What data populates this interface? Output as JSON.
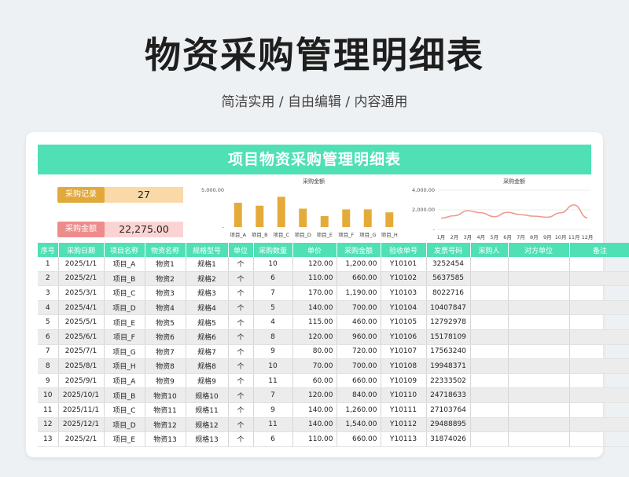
{
  "page": {
    "title": "物资采购管理明细表",
    "subtitle": "简洁实用 / 自由编辑 / 内容通用"
  },
  "sheet": {
    "banner": "项目物资采购管理明细表",
    "kpis": [
      {
        "label": "采购记录",
        "value": "27",
        "color": "#e2a93a"
      },
      {
        "label": "采购金额",
        "value": "22,275.00",
        "color": "#ee8c8c"
      }
    ]
  },
  "chart_data": [
    {
      "type": "bar",
      "title": "采购金额",
      "categories": [
        "项目_A",
        "项目_B",
        "项目_C",
        "项目_D",
        "项目_E",
        "项目_F",
        "项目_G",
        "项目_H"
      ],
      "values": [
        3300,
        2900,
        4100,
        2500,
        1500,
        2400,
        2400,
        2000
      ],
      "ylim": [
        0,
        5000
      ],
      "y_ticks": [
        "5,000.00",
        "-"
      ],
      "color": "#e5ab3a",
      "grid": false
    },
    {
      "type": "line",
      "title": "采购金额",
      "categories": [
        "1月",
        "2月",
        "3月",
        "4月",
        "5月",
        "6月",
        "7月",
        "8月",
        "9月",
        "10月",
        "11月",
        "12月"
      ],
      "values": [
        1150,
        1400,
        1900,
        1700,
        1300,
        1750,
        1500,
        1350,
        1250,
        1700,
        2500,
        1200
      ],
      "ylim": [
        0,
        4000
      ],
      "y_ticks": [
        "4,000.00",
        "2,000.00",
        "-"
      ],
      "color": "#ec9c8c",
      "grid": true
    }
  ],
  "table": {
    "headers": [
      "序号",
      "采购日期",
      "项目名称",
      "物资名称",
      "规格型号",
      "单位",
      "采购数量",
      "单价",
      "采购金额",
      "验收单号",
      "发票号码",
      "采购人",
      "对方单位",
      "备注"
    ],
    "rows": [
      [
        "1",
        "2025/1/1",
        "项目_A",
        "物资1",
        "规格1",
        "个",
        "10",
        "120.00",
        "1,200.00",
        "Y10101",
        "3252454",
        "",
        "",
        ""
      ],
      [
        "2",
        "2025/2/1",
        "项目_B",
        "物资2",
        "规格2",
        "个",
        "6",
        "110.00",
        "660.00",
        "Y10102",
        "5637585",
        "",
        "",
        ""
      ],
      [
        "3",
        "2025/3/1",
        "项目_C",
        "物资3",
        "规格3",
        "个",
        "7",
        "170.00",
        "1,190.00",
        "Y10103",
        "8022716",
        "",
        "",
        ""
      ],
      [
        "4",
        "2025/4/1",
        "项目_D",
        "物资4",
        "规格4",
        "个",
        "5",
        "140.00",
        "700.00",
        "Y10104",
        "10407847",
        "",
        "",
        ""
      ],
      [
        "5",
        "2025/5/1",
        "项目_E",
        "物资5",
        "规格5",
        "个",
        "4",
        "115.00",
        "460.00",
        "Y10105",
        "12792978",
        "",
        "",
        ""
      ],
      [
        "6",
        "2025/6/1",
        "项目_F",
        "物资6",
        "规格6",
        "个",
        "8",
        "120.00",
        "960.00",
        "Y10106",
        "15178109",
        "",
        "",
        ""
      ],
      [
        "7",
        "2025/7/1",
        "项目_G",
        "物资7",
        "规格7",
        "个",
        "9",
        "80.00",
        "720.00",
        "Y10107",
        "17563240",
        "",
        "",
        ""
      ],
      [
        "8",
        "2025/8/1",
        "项目_H",
        "物资8",
        "规格8",
        "个",
        "10",
        "70.00",
        "700.00",
        "Y10108",
        "19948371",
        "",
        "",
        ""
      ],
      [
        "9",
        "2025/9/1",
        "项目_A",
        "物资9",
        "规格9",
        "个",
        "11",
        "60.00",
        "660.00",
        "Y10109",
        "22333502",
        "",
        "",
        ""
      ],
      [
        "10",
        "2025/10/1",
        "项目_B",
        "物资10",
        "规格10",
        "个",
        "7",
        "120.00",
        "840.00",
        "Y10110",
        "24718633",
        "",
        "",
        ""
      ],
      [
        "11",
        "2025/11/1",
        "项目_C",
        "物资11",
        "规格11",
        "个",
        "9",
        "140.00",
        "1,260.00",
        "Y10111",
        "27103764",
        "",
        "",
        ""
      ],
      [
        "12",
        "2025/12/1",
        "项目_D",
        "物资12",
        "规格12",
        "个",
        "11",
        "140.00",
        "1,540.00",
        "Y10112",
        "29488895",
        "",
        "",
        ""
      ],
      [
        "13",
        "2025/2/1",
        "项目_E",
        "物资13",
        "规格13",
        "个",
        "6",
        "110.00",
        "660.00",
        "Y10113",
        "31874026",
        "",
        "",
        ""
      ]
    ]
  }
}
